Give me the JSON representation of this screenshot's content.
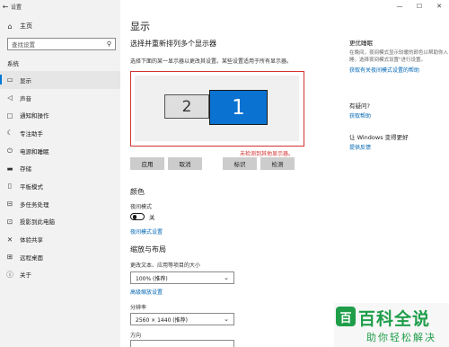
{
  "window": {
    "title": "设置",
    "back_icon": "←",
    "minimize": "—",
    "maximize": "☐",
    "close": "✕"
  },
  "sidebar": {
    "home": {
      "icon": "⌂",
      "label": "主页"
    },
    "search": {
      "placeholder": "查找设置",
      "icon": "⚲"
    },
    "section": "系统",
    "items": [
      {
        "icon": "▭",
        "label": "显示",
        "active": true
      },
      {
        "icon": "◁",
        "label": "声音"
      },
      {
        "icon": "▢",
        "label": "通知和操作"
      },
      {
        "icon": "☾",
        "label": "专注助手"
      },
      {
        "icon": "⏻",
        "label": "电源和睡眠"
      },
      {
        "icon": "▬",
        "label": "存储"
      },
      {
        "icon": "▯",
        "label": "平板模式"
      },
      {
        "icon": "⊟",
        "label": "多任务处理"
      },
      {
        "icon": "⊡",
        "label": "投影到此电脑"
      },
      {
        "icon": "✕",
        "label": "体验共享"
      },
      {
        "icon": "⊞",
        "label": "远程桌面"
      },
      {
        "icon": "ⓘ",
        "label": "关于"
      }
    ]
  },
  "main": {
    "title": "显示",
    "arrange_heading": "选择并重新排列多个显示器",
    "arrange_desc": "选择下面的某一显示器以更改其设置。某些设置适用于所有显示器。",
    "monitors": [
      "2",
      "1"
    ],
    "detect_message": "未检测到其他显示器。",
    "buttons": {
      "apply": "应用",
      "cancel": "取消",
      "identify": "标识",
      "detect": "检测"
    },
    "color_heading": "颜色",
    "night_mode_label": "夜间模式",
    "night_mode_state": "关",
    "night_mode_settings": "夜间模式设置",
    "scale_heading": "缩放与布局",
    "scale_label": "更改文本、应用等项目的大小",
    "scale_value": "100% (推荐)",
    "advanced_scale": "高级缩放设置",
    "resolution_label": "分辨率",
    "resolution_value": "2560 × 1440 (推荐)",
    "orientation_label": "方向"
  },
  "right": {
    "sleep_title": "更优睡眠",
    "sleep_text": "在晚间，夜间模式显示较暖的颜色以帮助你入睡。选择夜间模式设置\"进行设置。",
    "sleep_link": "获取有关夜间模式设置的帮助",
    "question_title": "有疑问?",
    "question_link": "获取帮助",
    "improve_title": "让 Windows 变得更好",
    "improve_link": "提供反馈"
  },
  "watermark": {
    "logo": "百",
    "title": "百科全说",
    "subtitle": "助你轻松解决"
  }
}
